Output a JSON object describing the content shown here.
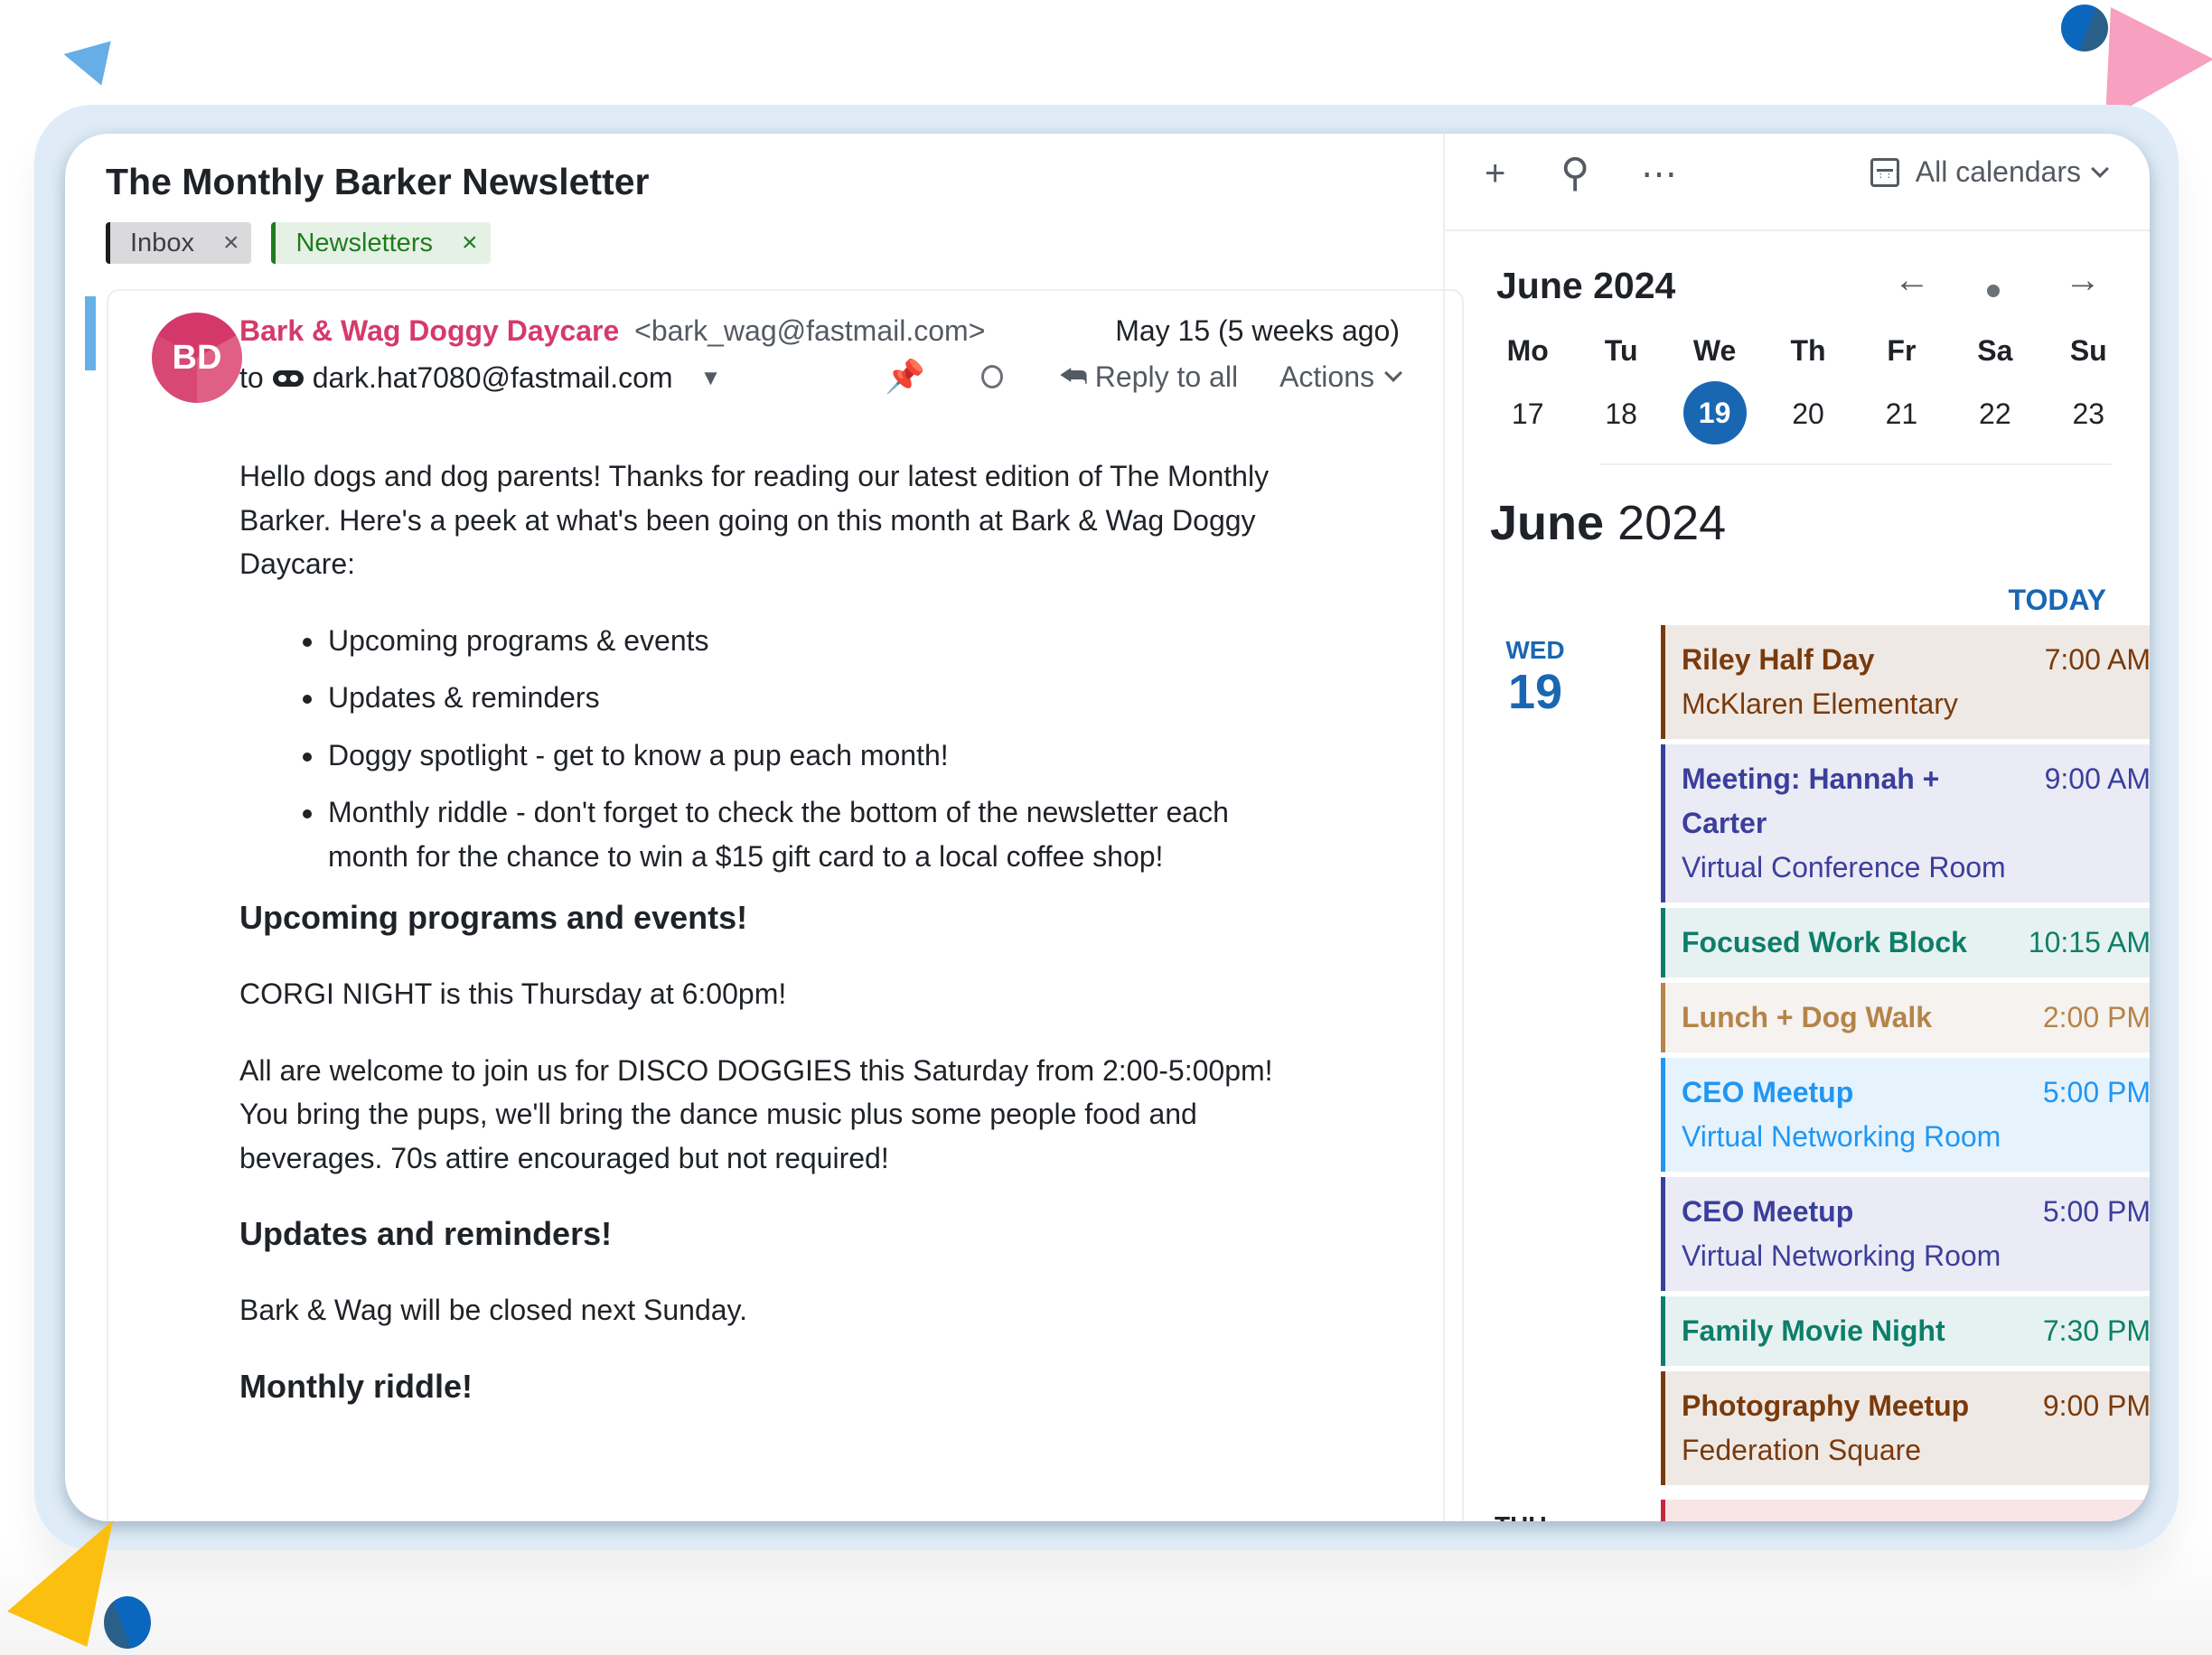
{
  "mail": {
    "subject": "The Monthly Barker Newsletter",
    "labels": [
      {
        "name": "Inbox",
        "remove_icon": "×"
      },
      {
        "name": "Newsletters",
        "remove_icon": "×"
      }
    ],
    "sender": {
      "initials": "BD",
      "name": "Bark & Wag Doggy Daycare",
      "email": "<bark_wag@fastmail.com>"
    },
    "date": "May 15 (5 weeks ago)",
    "to_prefix": "to",
    "recipient": "dark.hat7080@fastmail.com",
    "recipient_caret": "▼",
    "pin_icon": "📌",
    "reply_icon": "⮪",
    "reply_label": "Reply to all",
    "actions_label": "Actions",
    "body": {
      "intro": "Hello dogs and dog parents! Thanks for reading our latest edition of The Monthly Barker. Here's a peek at what's been going on this month at Bark & Wag Doggy Daycare:",
      "bullets": [
        "Upcoming programs & events",
        "Updates & reminders",
        "Doggy spotlight - get to know a pup each month!",
        "Monthly riddle - don't forget to check the bottom of the newsletter each month for the chance to win a $15 gift card to a local coffee shop!"
      ],
      "h_upcoming": "Upcoming programs and events!",
      "p_corgi": "CORGI NIGHT is this Thursday at 6:00pm!",
      "p_disco": "All are welcome to join us for DISCO DOGGIES this Saturday from 2:00-5:00pm! You bring the pups, we'll bring the dance music plus some people food and beverages. 70s attire encouraged but not required!",
      "h_updates": "Updates and reminders!",
      "p_closed": "Bark & Wag will be closed next Sunday.",
      "h_riddle": "Monthly riddle!"
    }
  },
  "calendar": {
    "toolbar": {
      "add_icon": "+",
      "search_icon": "⚲",
      "more_icon": "⋯",
      "calendars_label": "All calendars"
    },
    "mini": {
      "title": "June 2024",
      "prev_icon": "←",
      "next_icon": "→",
      "weekdays": [
        "Mo",
        "Tu",
        "We",
        "Th",
        "Fr",
        "Sa",
        "Su"
      ],
      "days": [
        "17",
        "18",
        "19",
        "20",
        "21",
        "22",
        "23"
      ],
      "today_index": 2
    },
    "agenda": {
      "month": "June",
      "year": "2024",
      "today_label": "TODAY",
      "day_of_week": "WED",
      "day_number": "19",
      "events": [
        {
          "title": "Riley Half Day",
          "time": "7:00 AM",
          "location": "McKlaren Elementary",
          "color": "#7a3a0c",
          "bg": "#efe9e5"
        },
        {
          "title": "Meeting: Hannah + Carter",
          "time": "9:00 AM",
          "location": "Virtual Conference Room",
          "color": "#3a3f9c",
          "bg": "#ebebf5"
        },
        {
          "title": "Focused Work Block",
          "time": "10:15 AM",
          "location": "",
          "color": "#0d7e6a",
          "bg": "#e6f2f1"
        },
        {
          "title": "Lunch + Dog Walk",
          "time": "2:00 PM",
          "location": "",
          "color": "#b5844a",
          "bg": "#f6f2ef"
        },
        {
          "title": "CEO Meetup",
          "time": "5:00 PM",
          "location": "Virtual Networking Room",
          "color": "#2196f3",
          "bg": "#e6f3fc"
        },
        {
          "title": "CEO Meetup",
          "time": "5:00 PM",
          "location": "Virtual Networking Room",
          "color": "#3a3f9c",
          "bg": "#ebebf5"
        },
        {
          "title": "Family Movie Night",
          "time": "7:30 PM",
          "location": "",
          "color": "#0d7e6a",
          "bg": "#e6f2f1"
        },
        {
          "title": "Photography Meetup",
          "time": "9:00 PM",
          "location": "Federation Square",
          "color": "#7a3a0c",
          "bg": "#efe9e5"
        }
      ],
      "next_day_label": "THU"
    }
  },
  "colors": {
    "accent_blue": "#1967b2",
    "sender_pink": "#d53a6b",
    "pin_red": "#c81e35"
  }
}
